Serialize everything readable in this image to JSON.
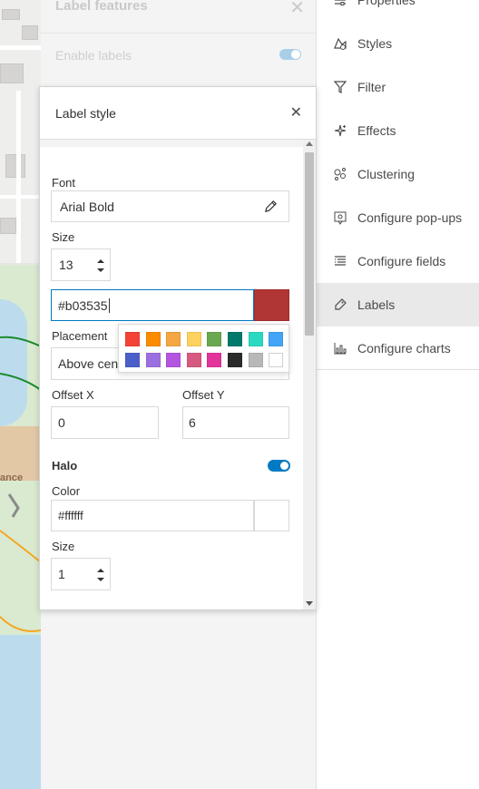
{
  "under_panel": {
    "title": "Label features",
    "enable_label": "Enable labels"
  },
  "map": {
    "label_fragment": "ance"
  },
  "rightnav": {
    "items": [
      {
        "label": "Properties",
        "icon": "properties-icon"
      },
      {
        "label": "Styles",
        "icon": "styles-icon"
      },
      {
        "label": "Filter",
        "icon": "filter-icon"
      },
      {
        "label": "Effects",
        "icon": "effects-icon"
      },
      {
        "label": "Clustering",
        "icon": "clustering-icon"
      },
      {
        "label": "Configure pop-ups",
        "icon": "popup-icon"
      },
      {
        "label": "Configure fields",
        "icon": "fields-icon"
      },
      {
        "label": "Labels",
        "icon": "labels-icon",
        "active": true
      },
      {
        "label": "Configure charts",
        "icon": "charts-icon"
      }
    ]
  },
  "dialog": {
    "title": "Label style",
    "font_label": "Font",
    "font_value": "Arial Bold",
    "size_label": "Size",
    "size_value": "13",
    "color_hex": "#b03535",
    "placement_label": "Placement",
    "placement_value": "Above cen",
    "offset_x_label": "Offset X",
    "offset_x_value": "0",
    "offset_y_label": "Offset Y",
    "offset_y_value": "6",
    "halo_label": "Halo",
    "halo_enabled": true,
    "halo_color_label": "Color",
    "halo_color_value": "#ffffff",
    "halo_size_label": "Size",
    "halo_size_value": "1"
  },
  "color_swatches": [
    "#f44336",
    "#fb8c00",
    "#f4a742",
    "#fdd25f",
    "#6aa84f",
    "#00796b",
    "#2bd9c1",
    "#42a5f5",
    "#4c5fc9",
    "#9b6fe0",
    "#b455e0",
    "#d65a80",
    "#e2359b",
    "#2b2b2b",
    "#b8b8b8",
    "#ffffff"
  ],
  "colors": {
    "accent": "#007ac2",
    "selected_color": "#b03535"
  }
}
